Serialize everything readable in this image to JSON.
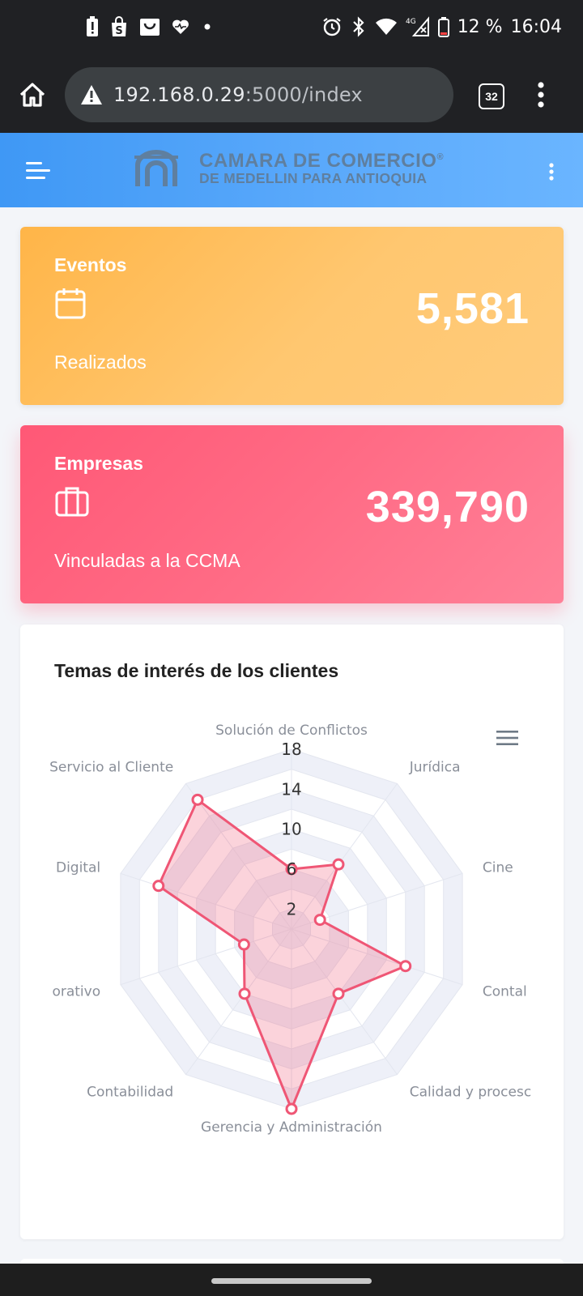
{
  "status_bar": {
    "battery": "12 %",
    "time": "16:04",
    "network": "4G"
  },
  "browser": {
    "url_host": "192.168.0.29",
    "url_rest": ":5000/index",
    "tab_count": "32"
  },
  "app_header": {
    "logo_line1": "CAMARA DE COMERCIO",
    "logo_line2": "DE MEDELLIN PARA ANTIOQUIA",
    "logo_mark": "®"
  },
  "cards": {
    "events": {
      "title": "Eventos",
      "value": "5,581",
      "subtitle": "Realizados",
      "icon": "calendar-icon",
      "color": "#ffbb55"
    },
    "companies": {
      "title": "Empresas",
      "value": "339,790",
      "subtitle": "Vinculadas a la CCMA",
      "icon": "briefcase-icon",
      "color": "#ff5c7a"
    }
  },
  "chart_card": {
    "title": "Temas de interés de los clientes"
  },
  "chart_data": {
    "type": "radar",
    "title": "Temas de interés de los clientes",
    "categories": [
      "Solución de Conflictos",
      "Jurídica",
      "Cine",
      "Contabilidad",
      "Calidad y procesos",
      "Gerencia y Administración",
      "Contabilidad",
      "Colaborativo",
      "Digital",
      "Servicio al Cliente"
    ],
    "category_labels_shown": [
      "Solución de Conflictos",
      "Jurídica",
      "Cine",
      "Contal",
      "Calidad y procesc",
      "Gerencia y Administración",
      "Contabilidad",
      "orativo",
      "Digital",
      "Servicio al Cliente"
    ],
    "series": [
      {
        "values": [
          6,
          8,
          3,
          12,
          8,
          18,
          8,
          5,
          14,
          16
        ],
        "color": "#ef5675"
      }
    ],
    "ticks": [
      "2",
      "6",
      "10",
      "14",
      "18"
    ],
    "rmax": 18,
    "grid": true
  }
}
